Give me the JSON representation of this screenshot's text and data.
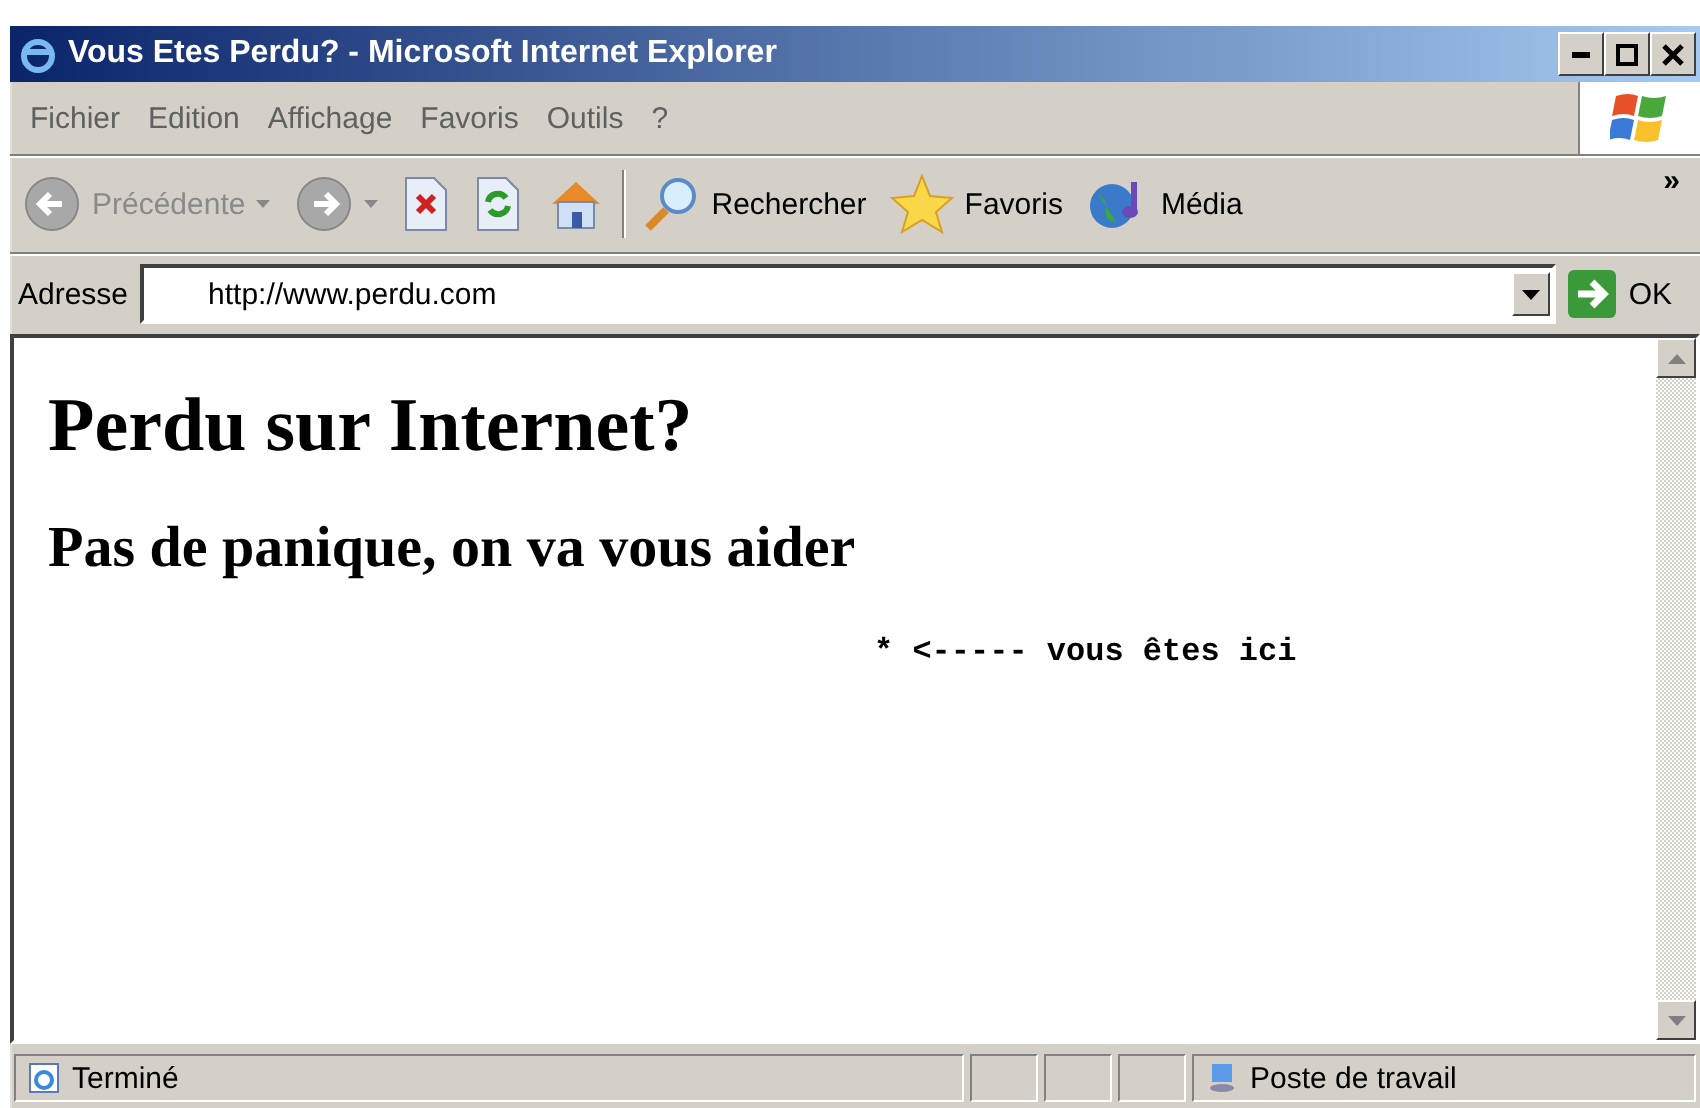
{
  "window": {
    "title": "Vous Etes Perdu? - Microsoft Internet Explorer"
  },
  "menu": [
    "Fichier",
    "Edition",
    "Affichage",
    "Favoris",
    "Outils",
    "?"
  ],
  "toolbar": {
    "buttons": [
      {
        "kind": "back",
        "label": "Précédente",
        "disabled": true
      },
      {
        "kind": "forward",
        "disabled": true
      },
      {
        "kind": "stop",
        "disabled": false
      },
      {
        "kind": "refresh",
        "disabled": false
      },
      {
        "kind": "home",
        "disabled": false
      },
      {
        "kind": "search",
        "label": "Rechercher",
        "disabled": false
      },
      {
        "kind": "favorites",
        "label": "Favoris",
        "disabled": false
      },
      {
        "kind": "media",
        "label": "Média",
        "disabled": false
      }
    ],
    "overflow": "»"
  },
  "address": {
    "label": "Adresse",
    "value": "http://www.perdu.com",
    "go": "OK"
  },
  "page": {
    "heading": "Perdu sur Internet?",
    "subheading": "Pas de panique, on va vous aider",
    "marker": "* <----- vous êtes ici"
  },
  "status_bar": {
    "text": "Terminé",
    "zone": "Poste de travail"
  }
}
